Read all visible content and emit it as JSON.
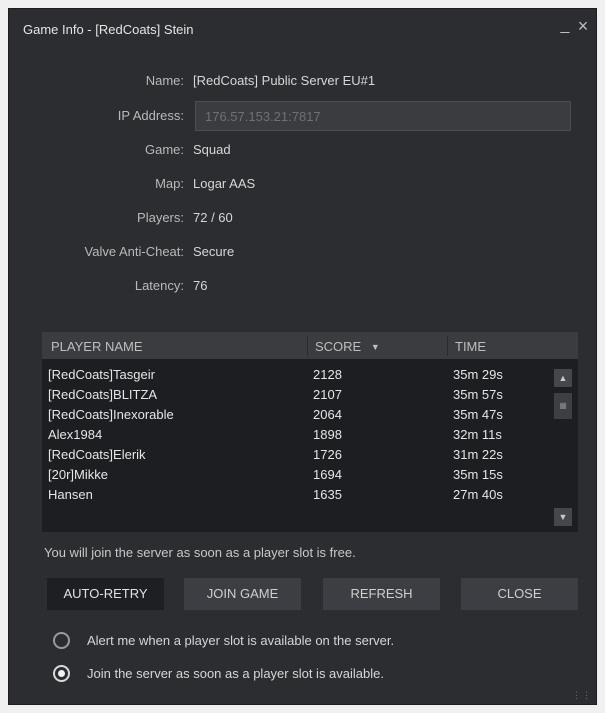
{
  "window": {
    "title": "Game Info - [RedCoats] Stein",
    "minimize_glyph": "_",
    "close_glyph": "×"
  },
  "info": {
    "name_label": "Name:",
    "name_value": "[RedCoats] Public Server EU#1",
    "ip_label": "IP Address:",
    "ip_value": "176.57.153.21:7817",
    "game_label": "Game:",
    "game_value": "Squad",
    "map_label": "Map:",
    "map_value": "Logar AAS",
    "players_label": "Players:",
    "players_value": "72 / 60",
    "vac_label": "Valve Anti-Cheat:",
    "vac_value": "Secure",
    "latency_label": "Latency:",
    "latency_value": "76"
  },
  "table": {
    "columns": {
      "player_name": "PLAYER NAME",
      "score": "SCORE",
      "time": "TIME"
    },
    "sort_icon": "sort-descending-icon",
    "rows": [
      {
        "name": "[RedCoats]Tasgeir",
        "score": "2128",
        "time": "35m 29s"
      },
      {
        "name": "[RedCoats]BLITZA",
        "score": "2107",
        "time": "35m 57s"
      },
      {
        "name": "[RedCoats]Inexorable",
        "score": "2064",
        "time": "35m 47s"
      },
      {
        "name": "Alex1984",
        "score": "1898",
        "time": "32m 11s"
      },
      {
        "name": "[RedCoats]Elerik",
        "score": "1726",
        "time": "31m 22s"
      },
      {
        "name": "[20r]Mikke",
        "score": "1694",
        "time": "35m 15s"
      },
      {
        "name": "Hansen",
        "score": "1635",
        "time": "27m 40s"
      }
    ]
  },
  "notice": "You will join the server as soon as a player slot is free.",
  "buttons": {
    "auto_retry": "AUTO-RETRY",
    "join_game": "JOIN GAME",
    "refresh": "REFRESH",
    "close": "CLOSE"
  },
  "options": {
    "alert_label": "Alert me when a player slot is available on the server.",
    "join_label": "Join the server as soon as a player slot is available.",
    "selected": "join"
  },
  "colors": {
    "window_bg": "#2c2d30",
    "table_bg": "#1d1e21",
    "header_bg": "#3b3c40"
  }
}
